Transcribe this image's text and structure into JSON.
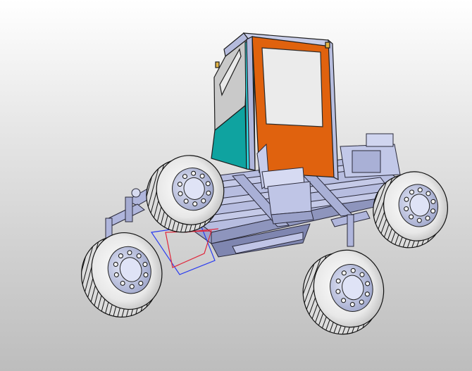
{
  "viewport": {
    "background_top": "#ffffff",
    "background_bottom": "#bdbdbd"
  },
  "model": {
    "cab_colors": {
      "door": "#e0620e",
      "side_teal": "#0fa3a0",
      "side_cyan": "#2fe0ea",
      "window": "#ebebeb",
      "frame": "#b9bfe0"
    },
    "tire_color": "#f2f2f2",
    "rim_color": "#c9d0ec",
    "triad_axes": {
      "x_color": "#e0263a",
      "y_color": "#1f9a2a",
      "z_color": "#2a3cf0"
    }
  }
}
